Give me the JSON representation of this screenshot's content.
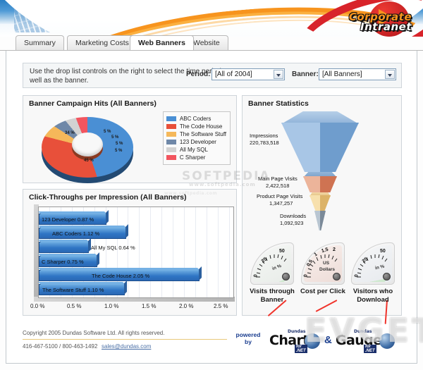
{
  "header": {
    "logo_line1": "Corporate",
    "logo_line2": "Intranet"
  },
  "tabs": [
    {
      "label": "Summary",
      "active": false
    },
    {
      "label": "Marketing Costs",
      "active": false
    },
    {
      "label": "Web Banners",
      "active": true
    },
    {
      "label": "Website",
      "active": false
    }
  ],
  "controls": {
    "instructions": "Use the drop list controls on the right to select the time period as well as the banner.",
    "period_label": "Period:",
    "period_value": "[All of 2004]",
    "banner_label": "Banner:",
    "banner_value": "[All Banners]"
  },
  "panels": {
    "pie_title": "Banner Campaign Hits (All Banners)",
    "bar_title": "Click-Throughs per Impression (All Banners)",
    "stats_title": "Banner Statistics"
  },
  "chart_data": [
    {
      "type": "pie",
      "title": "Banner Campaign Hits (All Banners)",
      "legend_position": "right",
      "labels": [
        "ABC Coders",
        "The Code House",
        "The Software Stuff",
        "123 Developer",
        "All My SQL",
        "C Sharper"
      ],
      "values": [
        45,
        34,
        5,
        5,
        5,
        5
      ],
      "value_labels": [
        "45 %",
        "34 %",
        "5 %",
        "5 %",
        "5 %",
        "5 %"
      ],
      "colors": [
        "#4a8fd4",
        "#e8503a",
        "#f5b85a",
        "#6f88a8",
        "#d2d2d2",
        "#f2555f"
      ]
    },
    {
      "type": "bar",
      "title": "Click-Throughs per Impression (All Banners)",
      "orientation": "horizontal",
      "xlabel": "",
      "ylabel": "",
      "xlim": [
        0.0,
        2.5
      ],
      "grid": true,
      "xticks": [
        "0.0 %",
        "0.5 %",
        "1.0 %",
        "1.5 %",
        "2.0 %",
        "2.5 %"
      ],
      "categories": [
        "123 Developer",
        "ABC Coders",
        "All My SQL",
        "C Sharper",
        "The Code House",
        "The Software Stuff"
      ],
      "values": [
        0.87,
        1.12,
        0.64,
        0.75,
        2.05,
        1.1
      ],
      "point_labels": [
        "123 Developer  0.87 %",
        "ABC Coders  1.12 %",
        "All My SQL  0.64 %",
        "C Sharper  0.75 %",
        "The Code House  2.05 %",
        "The Software Stuff  1.10 %"
      ],
      "bar_color": "#2f75c4"
    },
    {
      "type": "funnel",
      "title": "Banner Statistics",
      "categories": [
        "Impressions",
        "Main Page Visits",
        "Product Page Visits",
        "Downloads"
      ],
      "values": [
        220783518,
        2422518,
        1347257,
        1092923
      ],
      "value_labels": [
        "220,783,518",
        "2,422,518",
        "1,347,257",
        "1,092,923"
      ],
      "colors": [
        "#8fb6dd",
        "#e59b7e",
        "#f0cb8b",
        "#93a2ad"
      ]
    }
  ],
  "gauges": [
    {
      "caption_line1": "Visits through",
      "caption_line2": "Banner",
      "unit": "in %",
      "min_label": "0",
      "mid_label": "25",
      "max_label": "50",
      "value": 38,
      "range_max": 50,
      "band_color": "#b8e6b8",
      "needle_color": "#f0342c"
    },
    {
      "caption_line1": "Cost per Click",
      "caption_line2": "",
      "unit_line1": "US",
      "unit_line2": "Dollars",
      "min_label": "0",
      "tick_labels": [
        "0",
        "0.5",
        "1",
        "1.5",
        "2"
      ],
      "value": 0.62,
      "range_max": 2,
      "needle_color": "#f0342c"
    },
    {
      "caption_line1": "Visitors who",
      "caption_line2": "Download",
      "unit": "in %",
      "min_label": "0",
      "mid_label": "25",
      "max_label": "50",
      "value": 49,
      "range_max": 50,
      "band_color": "#b8e6b8",
      "needle_color": "#f0342c"
    }
  ],
  "footer": {
    "copyright": "Copyright 2005 Dundas Software Ltd. All rights reserved.",
    "phone": "416-467-5100 / 800-463-1492",
    "email": "sales@dundas.com",
    "powered_line1": "powered",
    "powered_line2": "by",
    "brand_small_1": "Dundas",
    "brand_big_1": "Chart",
    "brand_net_1": "for .NET",
    "ampersand": "&",
    "brand_small_2": "Dundas",
    "brand_big_2": "Gauge",
    "brand_net_2": "for .NET"
  },
  "watermarks": {
    "softpedia": "SOFTPEDIA",
    "softpedia_url": "www.softpedia.com",
    "evget": "EVGET"
  }
}
